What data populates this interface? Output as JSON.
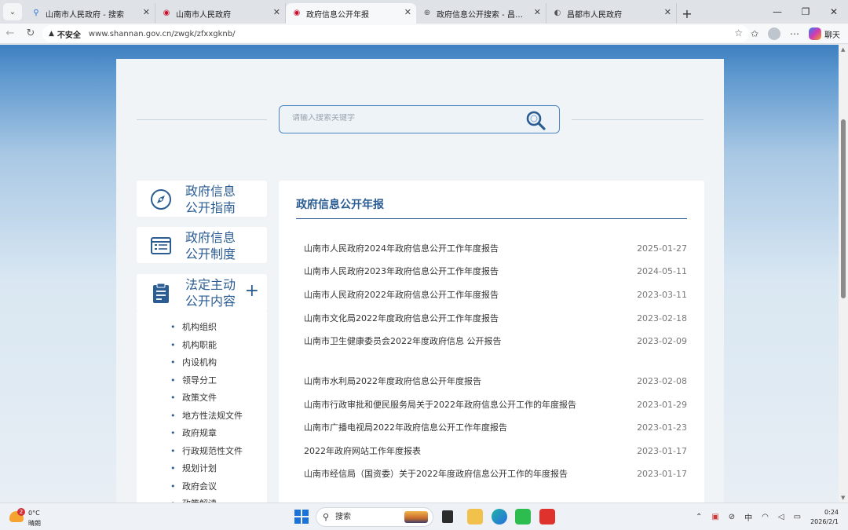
{
  "browser": {
    "tabs": [
      {
        "title": "山南市人民政府 - 搜索",
        "icon": "search-icon",
        "active": false
      },
      {
        "title": "山南市人民政府",
        "icon": "emblem-icon",
        "active": false
      },
      {
        "title": "政府信息公开年报",
        "icon": "emblem-icon",
        "active": true
      },
      {
        "title": "政府信息公开搜索 - 昌都市人民政",
        "icon": "globe-icon",
        "active": false
      },
      {
        "title": "昌都市人民政府",
        "icon": "page-icon",
        "active": false
      }
    ],
    "address": {
      "security_label": "不安全",
      "url": "www.shannan.gov.cn/zwgk/zfxxgknb/"
    },
    "chat_label": "聊天"
  },
  "page": {
    "search": {
      "placeholder": "请输入搜索关键字"
    },
    "sidebar": {
      "cards": [
        {
          "line1": "政府信息",
          "line2": "公开指南",
          "icon": "compass-icon"
        },
        {
          "line1": "政府信息",
          "line2": "公开制度",
          "icon": "document-list-icon"
        },
        {
          "line1": "法定主动",
          "line2": "公开内容",
          "icon": "clipboard-icon",
          "expand": "+"
        }
      ],
      "sub_items": [
        "机构组织",
        "机构职能",
        "内设机构",
        "领导分工",
        "政策文件",
        "地方性法规文件",
        "政府规章",
        "行政规范性文件",
        "规划计划",
        "政府会议",
        "政策解读"
      ]
    },
    "main": {
      "heading": "政府信息公开年报",
      "reports": [
        {
          "title": "山南市人民政府2024年政府信息公开工作年度报告",
          "date": "2025-01-27"
        },
        {
          "title": "山南市人民政府2023年政府信息公开工作年度报告",
          "date": "2024-05-11"
        },
        {
          "title": "山南市人民政府2022年政府信息公开工作年度报告",
          "date": "2023-03-11"
        },
        {
          "title": "山南市文化局2022年度政府信息公开工作年度报告",
          "date": "2023-02-18"
        },
        {
          "title": "山南市卫生健康委员会2022年度政府信息 公开报告",
          "date": "2023-02-09"
        },
        {
          "title": "山南市水利局2022年度政府信息公开年度报告",
          "date": "2023-02-08"
        },
        {
          "title": "山南市行政审批和便民服务局关于2022年政府信息公开工作的年度报告",
          "date": "2023-01-29"
        },
        {
          "title": "山南市广播电视局2022年政府信息公开工作年度报告",
          "date": "2023-01-23"
        },
        {
          "title": "2022年政府网站工作年度报表",
          "date": "2023-01-17"
        },
        {
          "title": "山南市经信局（国资委）关于2022年度政府信息公开工作的年度报告",
          "date": "2023-01-17"
        }
      ]
    }
  },
  "taskbar": {
    "weather": {
      "badge": "2",
      "temp": "0°C",
      "condition": "晴朗"
    },
    "search_label": "搜索",
    "ime": "中",
    "time": "0:24",
    "date": "2026/2/1"
  },
  "colors": {
    "accent": "#2b5d93",
    "search_border": "#4b86c4",
    "header_blue": "#3e7fc1"
  }
}
